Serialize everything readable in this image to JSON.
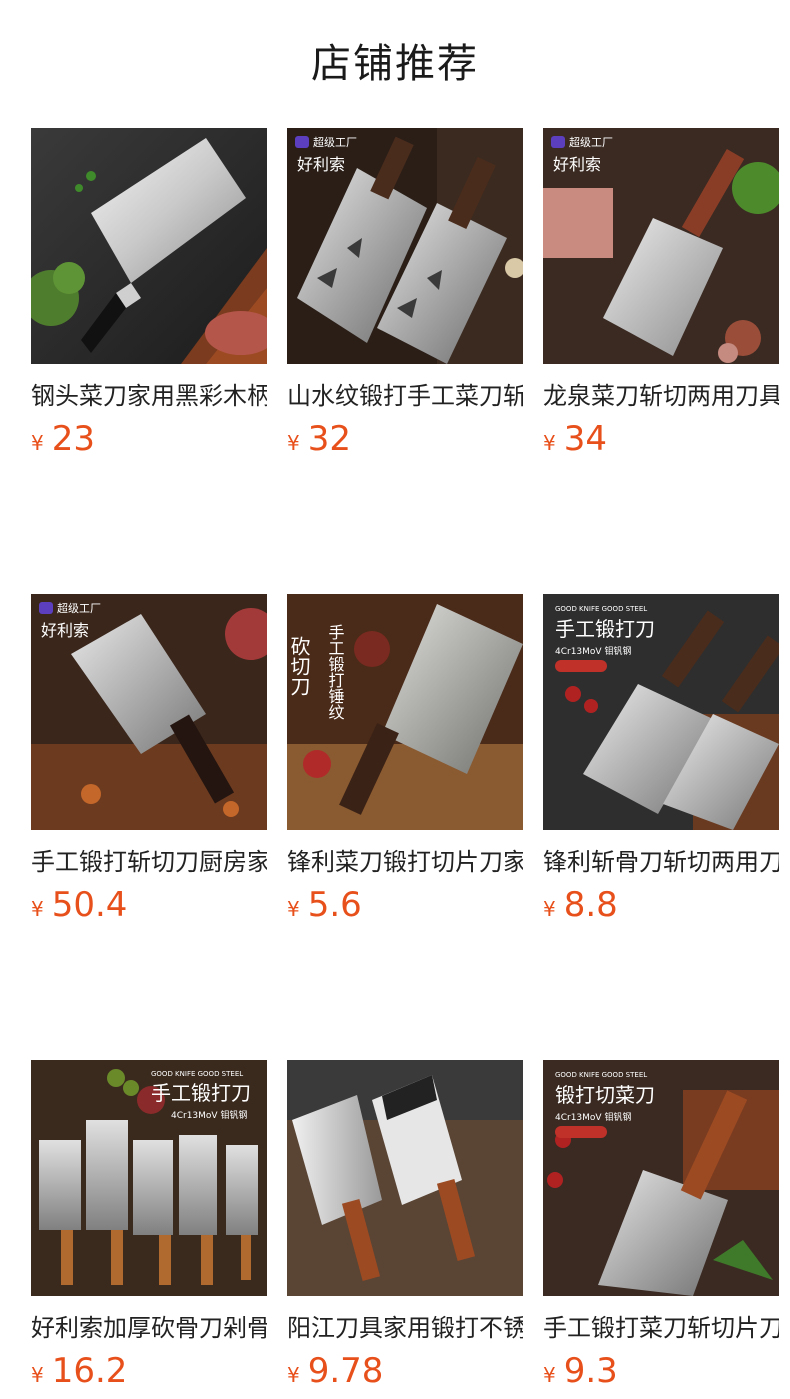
{
  "page": {
    "title": "店铺推荐"
  },
  "products": [
    {
      "name": "钢头菜刀家用黑彩木柄",
      "currency": "¥",
      "price": "23",
      "badge": "",
      "brand": "",
      "slogan": "",
      "steel": ""
    },
    {
      "name": "山水纹锻打手工菜刀斩",
      "currency": "¥",
      "price": "32",
      "badge": "超级工厂",
      "brand": "好利索",
      "slogan": "",
      "steel": ""
    },
    {
      "name": "龙泉菜刀斩切两用刀具",
      "currency": "¥",
      "price": "34",
      "badge": "超级工厂",
      "brand": "好利索",
      "slogan": "",
      "steel": ""
    },
    {
      "name": "手工锻打斩切刀厨房家",
      "currency": "¥",
      "price": "50.4",
      "badge": "超级工厂",
      "brand": "好利索",
      "slogan": "",
      "steel": ""
    },
    {
      "name": "锋利菜刀锻打切片刀家",
      "currency": "¥",
      "price": "5.6",
      "badge": "",
      "brand": "",
      "slogan": "砍切刀",
      "steel": "手工锻打锤纹"
    },
    {
      "name": "锋利斩骨刀斩切两用刀",
      "currency": "¥",
      "price": "8.8",
      "badge": "GOOD KNIFE GOOD STEEL",
      "brand": "",
      "slogan": "手工锻打刀",
      "steel": "4Cr13MoV 钼钒钢"
    },
    {
      "name": "好利索加厚砍骨刀剁骨",
      "currency": "¥",
      "price": "16.2",
      "badge": "GOOD KNIFE GOOD STEEL",
      "brand": "",
      "slogan": "手工锻打刀",
      "steel": "4Cr13MoV 钼钒钢"
    },
    {
      "name": "阳江刀具家用锻打不锈",
      "currency": "¥",
      "price": "9.78",
      "badge": "",
      "brand": "",
      "slogan": "",
      "steel": ""
    },
    {
      "name": "手工锻打菜刀斩切片刀",
      "currency": "¥",
      "price": "9.3",
      "badge": "GOOD KNIFE GOOD STEEL",
      "brand": "",
      "slogan": "锻打切菜刀",
      "steel": "4Cr13MoV 钼钒钢"
    }
  ]
}
